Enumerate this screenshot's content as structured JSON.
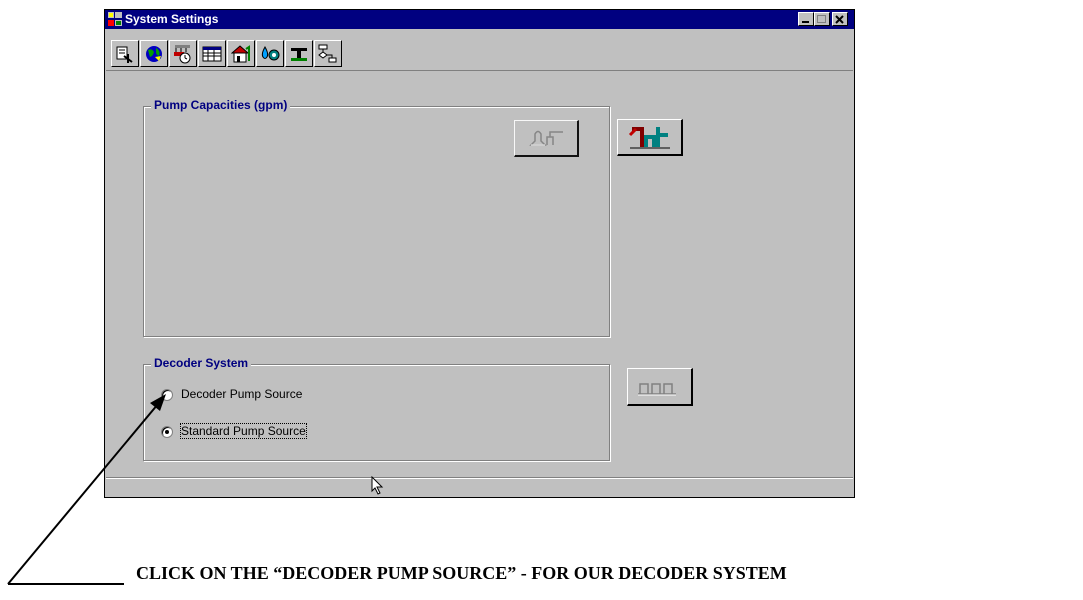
{
  "window": {
    "title": "System Settings",
    "buttons": [
      "minimize",
      "maximize",
      "close"
    ]
  },
  "toolbar": {
    "icons": [
      "site-icon",
      "globe-icon",
      "controller-clock-icon",
      "table-icon",
      "house-icon",
      "water-drop-icon",
      "pipe-icon",
      "flowchart-icon"
    ]
  },
  "pump_capacities": {
    "legend": "Pump Capacities (gpm)"
  },
  "decoder_system": {
    "legend": "Decoder System",
    "options": [
      {
        "label": "Decoder Pump Source",
        "selected": false
      },
      {
        "label": "Standard Pump Source",
        "selected": true
      }
    ]
  },
  "caption": "CLICK ON THE “DECODER PUMP SOURCE” - FOR OUR DECODER SYSTEM",
  "colors": {
    "titlebar": "#000080",
    "window": "#c0c0c0",
    "legend_text": "#000080",
    "pipe_teal": "#008080",
    "pipe_red": "#800000"
  }
}
